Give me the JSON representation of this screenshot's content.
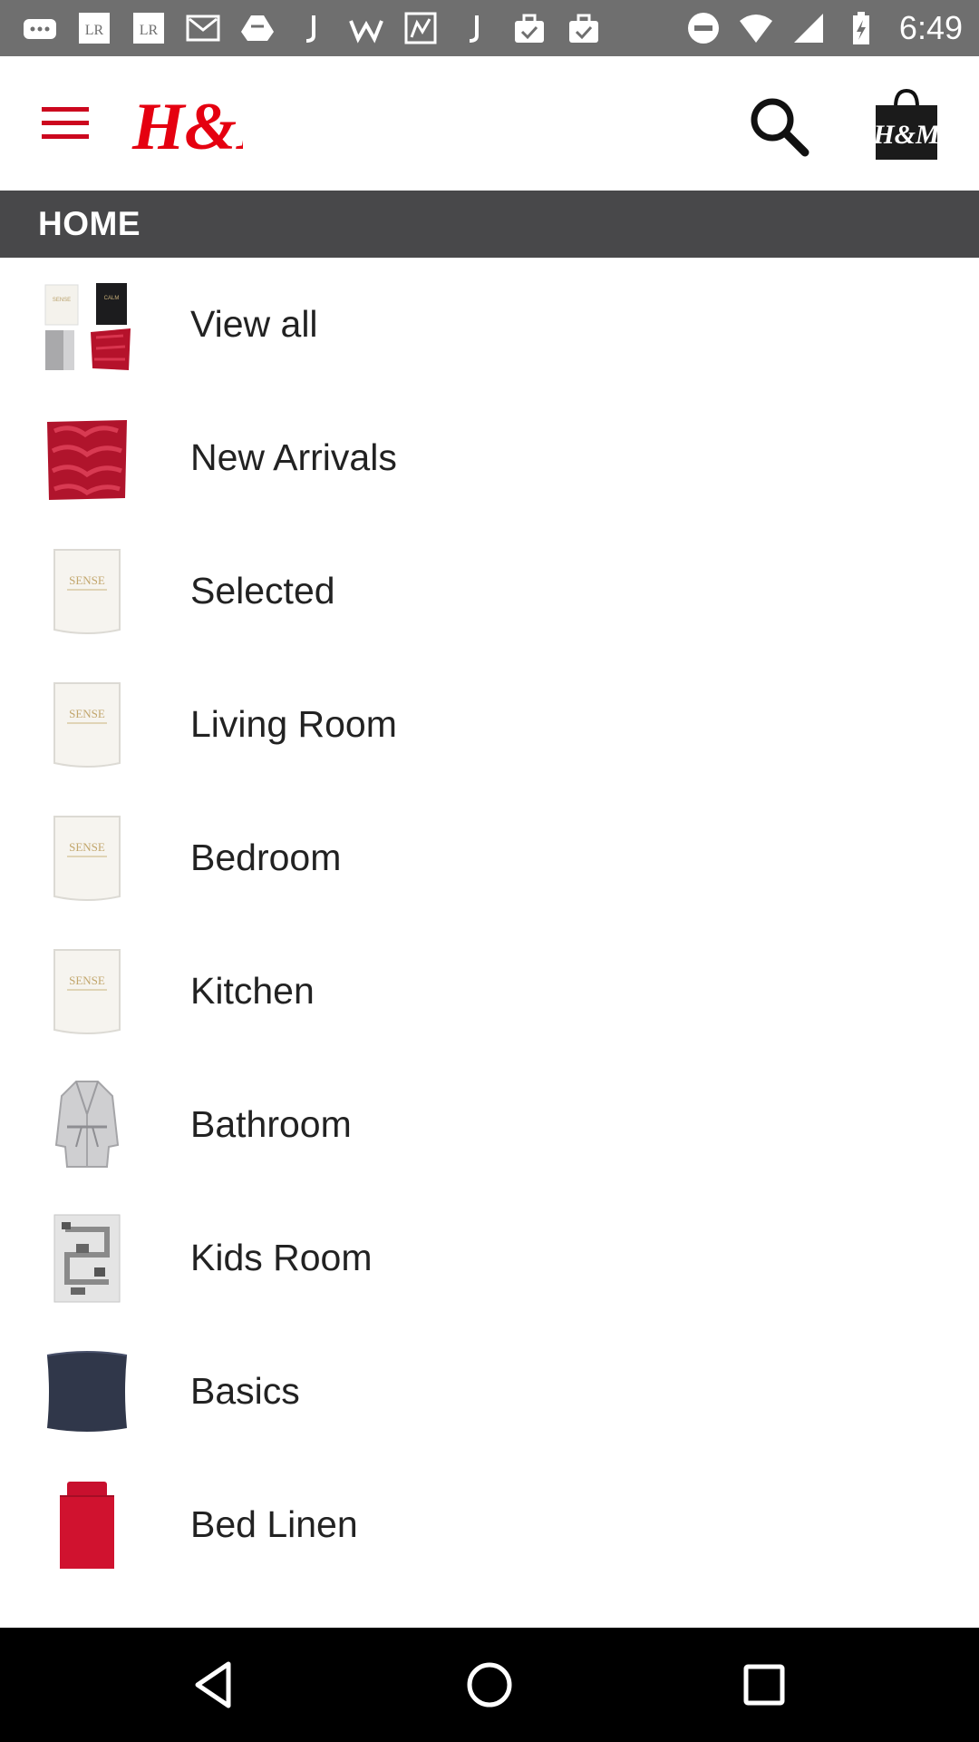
{
  "status_bar": {
    "time": "6:49",
    "left_icons": [
      "more-icon",
      "lr-icon",
      "lr-icon",
      "mail-icon",
      "drive-icon",
      "j-icon",
      "w-icon",
      "map-icon",
      "j-icon",
      "briefcase-check-icon",
      "briefcase-check-icon"
    ],
    "right_icons": [
      "do-not-disturb-icon",
      "wifi-icon",
      "signal-icon",
      "battery-charging-icon"
    ]
  },
  "header": {
    "brand": "H&M",
    "bag_brand": "H&M",
    "brand_color": "#e50010"
  },
  "section": {
    "title": "HOME"
  },
  "categories": [
    {
      "label": "View all",
      "thumb": "collage-thumb"
    },
    {
      "label": "New Arrivals",
      "thumb": "red-cushion-thumb"
    },
    {
      "label": "Selected",
      "thumb": "candle-thumb"
    },
    {
      "label": "Living Room",
      "thumb": "candle-thumb"
    },
    {
      "label": "Bedroom",
      "thumb": "candle-thumb"
    },
    {
      "label": "Kitchen",
      "thumb": "candle-thumb"
    },
    {
      "label": "Bathroom",
      "thumb": "bathrobe-thumb"
    },
    {
      "label": "Kids Room",
      "thumb": "play-rug-thumb"
    },
    {
      "label": "Basics",
      "thumb": "navy-cushion-thumb"
    },
    {
      "label": "Bed Linen",
      "thumb": "red-bedding-thumb"
    }
  ],
  "thumb_text": {
    "candle": "SENSE",
    "candle_small": "SENSE",
    "candle_black": "CALM"
  },
  "nav": {
    "icons": [
      "back-icon",
      "home-icon",
      "recents-icon"
    ]
  }
}
